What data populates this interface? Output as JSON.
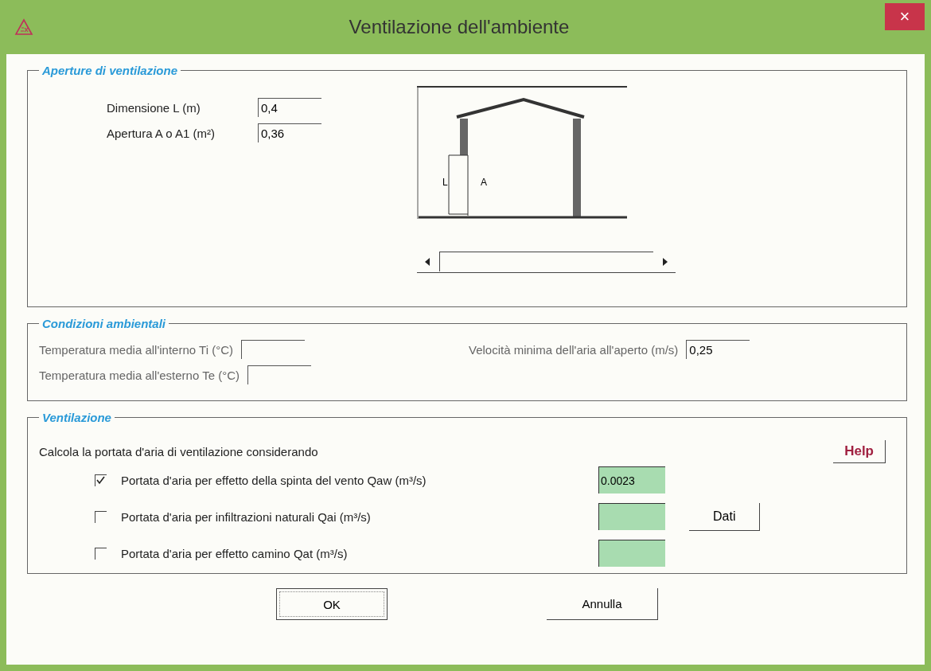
{
  "window": {
    "title": "Ventilazione dell'ambiente",
    "close": "×"
  },
  "openings": {
    "legend": "Aperture di ventilazione",
    "fields": [
      {
        "label": "Dimensione L (m)",
        "value": "0,4"
      },
      {
        "label": "Apertura A o A1 (m²)",
        "value": "0,36"
      }
    ],
    "diagram": {
      "labels": [
        "L",
        "A"
      ]
    }
  },
  "conditions": {
    "legend": "Condizioni ambientali",
    "fields": [
      {
        "label": "Temperatura media all'interno Ti (°C)"
      },
      {
        "label": "Velocità minima dell'aria all'aperto (m/s)",
        "value": "0,25"
      },
      {
        "label": "Temperatura media all'esterno Te (°C)"
      }
    ]
  },
  "ventilation": {
    "legend": "Ventilazione",
    "intro": "Calcola la portata d'aria di ventilazione considerando",
    "help": "Help",
    "options": [
      {
        "label": "Portata d'aria per effetto della spinta del vento Qaw (m³/s)",
        "checked": true,
        "result": "0.0023"
      },
      {
        "label": "Portata d'aria per infiltrazioni naturali Qai (m³/s)",
        "checked": false
      },
      {
        "label": "Portata d'aria per effetto camino Qat (m³/s)",
        "checked": false
      }
    ],
    "data_button": "Dati"
  },
  "buttons": [
    "OK",
    "Annulla"
  ]
}
